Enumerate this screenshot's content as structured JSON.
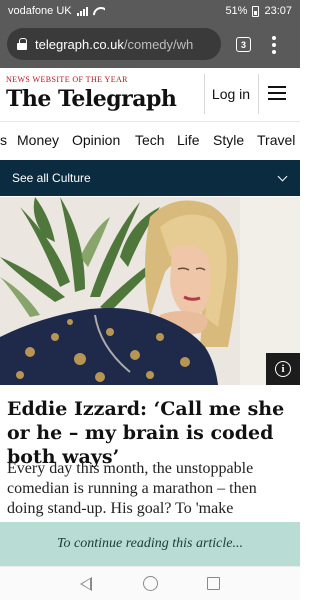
{
  "status_bar": {
    "carrier": "vodafone UK",
    "battery": "51%",
    "time": "23:07"
  },
  "browser": {
    "url_domain": "telegraph.co.uk",
    "url_path": "/comedy/wh",
    "tab_count": "3"
  },
  "site": {
    "tagline": "News website of the year",
    "logo": "The Telegraph",
    "login_label": "Log in"
  },
  "nav": {
    "items": [
      "s",
      "Money",
      "Opinion",
      "Tech",
      "Life",
      "Style",
      "Travel"
    ]
  },
  "culture_bar": {
    "label": "See all Culture"
  },
  "article": {
    "headline": "Eddie Izzard: ‘Call me she or he – my brain is coded both ways’",
    "standfirst": "Every day this month, the unstoppable comedian is running a marathon – then doing stand-up. His goal? To 'make"
  },
  "paywall": {
    "text": "To continue reading this article..."
  },
  "colors": {
    "chrome": "#5a5a5a",
    "brand_red": "#b5121b",
    "culture_bar": "#0b2c40",
    "paywall": "#b9ddd5"
  },
  "icons": [
    "lock-icon",
    "tab-switcher-icon",
    "overflow-menu-icon",
    "hamburger-menu-icon",
    "chevron-down-icon",
    "info-icon",
    "back-icon",
    "home-icon",
    "recents-icon"
  ]
}
